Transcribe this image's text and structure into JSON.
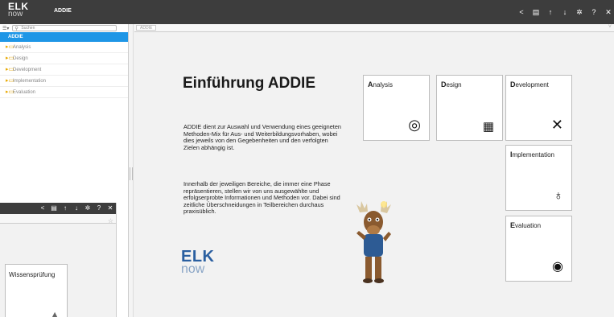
{
  "app": {
    "logo_top": "ELK",
    "logo_bottom": "now",
    "title": "ADDIE"
  },
  "toolbar": {
    "icons": [
      {
        "name": "share-icon",
        "glyph": "<"
      },
      {
        "name": "notes-icon",
        "glyph": "▤"
      },
      {
        "name": "arrow-up-icon",
        "glyph": "↑"
      },
      {
        "name": "arrow-down-icon",
        "glyph": "↓"
      },
      {
        "name": "gear-icon",
        "glyph": "✲"
      },
      {
        "name": "help-icon",
        "glyph": "?"
      },
      {
        "name": "close-icon",
        "glyph": "✕"
      }
    ]
  },
  "sidebar": {
    "search_placeholder": "Suchen",
    "root": "ADDIE",
    "items": [
      "Analysis",
      "Design",
      "Development",
      "Implementation",
      "Evaluation"
    ]
  },
  "breadcrumb": "ADDIE",
  "main": {
    "heading": "Einführung ADDIE",
    "paragraph1": "ADDIE dient zur Auswahl und Verwendung eines geeigneten Methoden-Mix für Aus- und Weiterbildungsvorhaben, wobei dies jeweils von den Gegebenheiten und den verfolgten Zielen abhängig ist.",
    "paragraph2": "Innerhalb der jeweiligen Bereiche, die immer eine Phase repräsentieren, stellen wir von uns ausgewählte und erfolgserprobte Informationen und Methoden vor. Dabei sind zeitliche Überschneidungen in Teilbereichen durchaus praxisüblich.",
    "brand_top": "ELK",
    "brand_bottom": "now",
    "cards": [
      {
        "initial": "A",
        "rest": "nalysis",
        "icon": "target-icon"
      },
      {
        "initial": "D",
        "rest": "esign",
        "icon": "grid-sketch-icon"
      },
      {
        "initial": "D",
        "rest": "evelopment",
        "icon": "tools-icon"
      },
      {
        "initial": "I",
        "rest": "mplementation",
        "icon": "lightbulb-icon"
      },
      {
        "initial": "E",
        "rest": "valuation",
        "icon": "eye-icon"
      }
    ]
  },
  "second_window": {
    "card_title": "Wissensprüfung",
    "card_icon": "graduation-cap-icon"
  }
}
